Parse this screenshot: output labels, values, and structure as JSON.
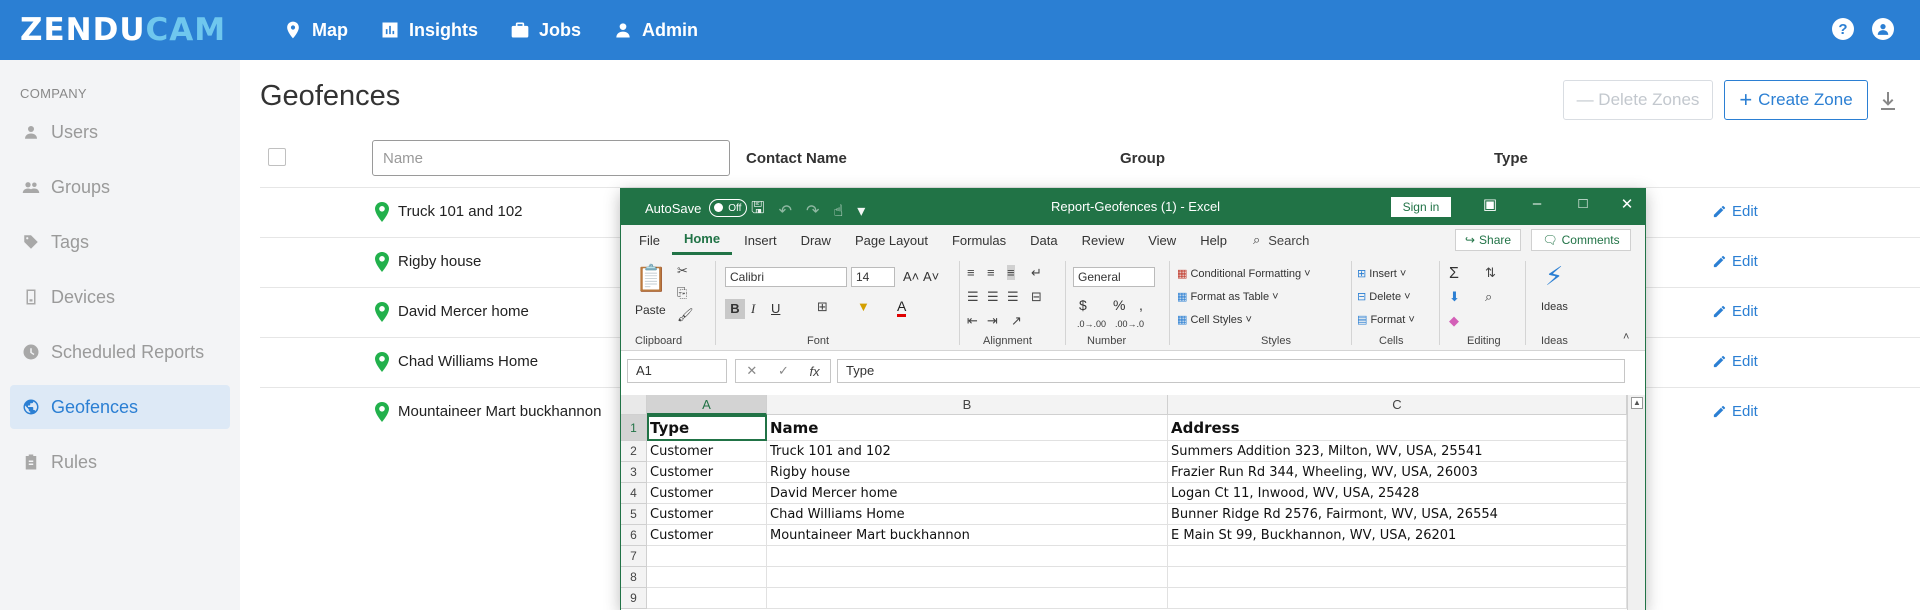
{
  "app": {
    "logo_part1": "ZENDU",
    "logo_part2": "CAM"
  },
  "nav": {
    "items": [
      {
        "label": "Map",
        "icon": "map-pin-icon"
      },
      {
        "label": "Insights",
        "icon": "chart-icon"
      },
      {
        "label": "Jobs",
        "icon": "briefcase-icon"
      },
      {
        "label": "Admin",
        "icon": "user-icon"
      }
    ],
    "help": "?",
    "help_icon": "help-icon",
    "account_icon": "account-icon"
  },
  "sidebar": {
    "section": "COMPANY",
    "items": [
      {
        "label": "Users",
        "icon": "user-icon"
      },
      {
        "label": "Groups",
        "icon": "groups-icon"
      },
      {
        "label": "Tags",
        "icon": "tag-icon"
      },
      {
        "label": "Devices",
        "icon": "device-icon"
      },
      {
        "label": "Scheduled Reports",
        "icon": "clock-icon"
      },
      {
        "label": "Geofences",
        "icon": "globe-icon",
        "active": true
      },
      {
        "label": "Rules",
        "icon": "clipboard-icon"
      }
    ]
  },
  "page": {
    "title": "Geofences",
    "delete_label": "— Delete Zones",
    "create_label": "Create Zone",
    "create_plus": "+",
    "name_placeholder": "Name",
    "columns": {
      "contact": "Contact Name",
      "group": "Group",
      "type": "Type"
    },
    "edit_label": "Edit",
    "rows": [
      {
        "name": "Truck 101 and 102"
      },
      {
        "name": "Rigby house"
      },
      {
        "name": "David Mercer home"
      },
      {
        "name": "Chad Williams Home"
      },
      {
        "name": "Mountaineer Mart buckhannon"
      }
    ],
    "accent": "#2b7fd3"
  },
  "excel": {
    "autosave_label": "AutoSave",
    "autosave_state": "Off",
    "title": "Report-Geofences (1)  -  Excel",
    "signin": "Sign in",
    "tabs": [
      "File",
      "Home",
      "Insert",
      "Draw",
      "Page Layout",
      "Formulas",
      "Data",
      "Review",
      "View",
      "Help"
    ],
    "active_tab": "Home",
    "search": "Search",
    "share": "Share",
    "comments": "Comments",
    "ribbon": {
      "paste": "Paste",
      "font_name": "Calibri",
      "font_size": "14",
      "bold": "B",
      "italic": "I",
      "underline": "U",
      "number_format": "General",
      "dollar": "$",
      "percent": "%",
      "conditional": "Conditional Formatting",
      "format_table": "Format as Table",
      "cell_styles": "Cell Styles",
      "insert": "Insert",
      "delete": "Delete",
      "format": "Format",
      "ideas": "Ideas",
      "sigma": "Σ",
      "groups": [
        "Clipboard",
        "Font",
        "Alignment",
        "Number",
        "Styles",
        "Cells",
        "Editing",
        "Ideas"
      ]
    },
    "name_box": "A1",
    "fx": "fx",
    "formula": "Type",
    "columns": [
      "A",
      "B",
      "C"
    ],
    "row_numbers": [
      "1",
      "2",
      "3",
      "4",
      "5",
      "6",
      "7",
      "8",
      "9"
    ],
    "grid": [
      [
        "Type",
        "Name",
        "Address"
      ],
      [
        "Customer",
        "Truck 101 and 102",
        "Summers Addition 323, Milton, WV, USA, 25541"
      ],
      [
        "Customer",
        "Rigby house",
        "Frazier Run Rd 344, Wheeling, WV, USA, 26003"
      ],
      [
        "Customer",
        "David Mercer home",
        "Logan Ct 11, Inwood, WV, USA, 25428"
      ],
      [
        "Customer",
        "Chad Williams Home",
        "Bunner Ridge Rd 2576, Fairmont, WV, USA, 26554"
      ],
      [
        "Customer",
        "Mountaineer Mart buckhannon",
        "E Main St 99, Buckhannon, WV, USA, 26201"
      ],
      [
        "",
        "",
        ""
      ],
      [
        "",
        "",
        ""
      ],
      [
        "",
        "",
        ""
      ]
    ],
    "accent": "#217346"
  }
}
